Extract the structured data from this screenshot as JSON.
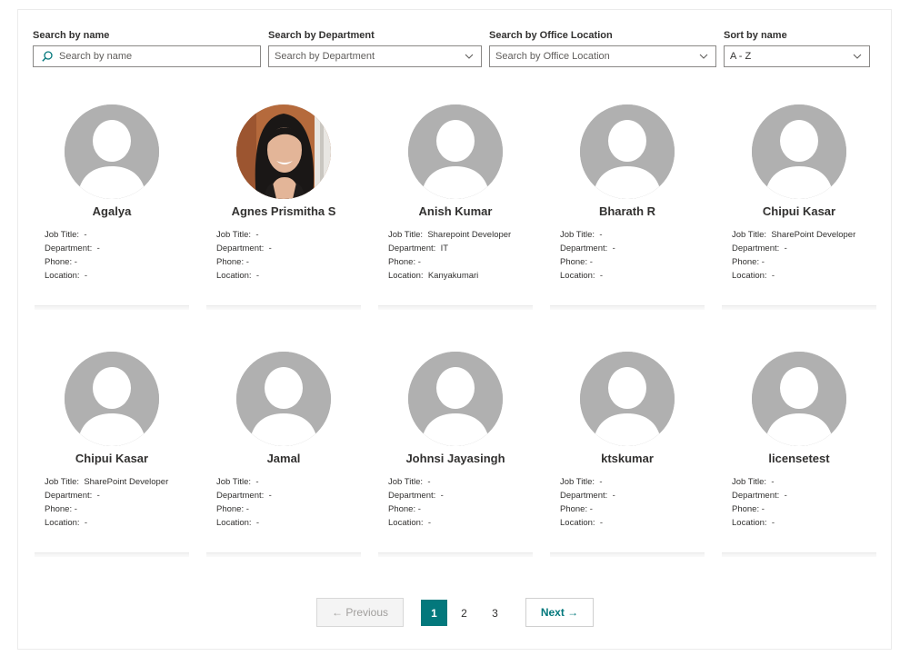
{
  "filters": {
    "name": {
      "label": "Search by name",
      "placeholder": "Search by name"
    },
    "department": {
      "label": "Search by Department",
      "placeholder": "Search by Department"
    },
    "location": {
      "label": "Search by Office Location",
      "placeholder": "Search by Office Location"
    },
    "sort": {
      "label": "Sort by name",
      "value": "A - Z"
    }
  },
  "field_labels": {
    "job_title": "Job Title:",
    "department": "Department:",
    "phone": "Phone:",
    "location": "Location:"
  },
  "people": [
    {
      "name": "Agalya",
      "job_title": "-",
      "department": "-",
      "phone": "-",
      "location": "-",
      "photo": false
    },
    {
      "name": "Agnes Prismitha S",
      "job_title": "-",
      "department": "-",
      "phone": "-",
      "location": "-",
      "photo": true
    },
    {
      "name": "Anish Kumar",
      "job_title": "Sharepoint Developer",
      "department": "IT",
      "phone": "-",
      "location": "Kanyakumari",
      "photo": false
    },
    {
      "name": "Bharath R",
      "job_title": "-",
      "department": "-",
      "phone": "-",
      "location": "-",
      "photo": false
    },
    {
      "name": "Chipui Kasar",
      "job_title": "SharePoint Developer",
      "department": "-",
      "phone": "-",
      "location": "-",
      "photo": false
    },
    {
      "name": "Chipui Kasar",
      "job_title": "SharePoint Developer",
      "department": "-",
      "phone": "-",
      "location": "-",
      "photo": false
    },
    {
      "name": "Jamal",
      "job_title": "-",
      "department": "-",
      "phone": "-",
      "location": "-",
      "photo": false
    },
    {
      "name": "Johnsi Jayasingh",
      "job_title": "-",
      "department": "-",
      "phone": "-",
      "location": "-",
      "photo": false
    },
    {
      "name": "ktskumar",
      "job_title": "-",
      "department": "-",
      "phone": "-",
      "location": "-",
      "photo": false
    },
    {
      "name": "licensetest",
      "job_title": "-",
      "department": "-",
      "phone": "-",
      "location": "-",
      "photo": false
    }
  ],
  "pagination": {
    "previous": "← Previous",
    "next": "Next →",
    "pages": [
      "1",
      "2",
      "3"
    ],
    "current": "1"
  },
  "colors": {
    "accent": "#03787c",
    "avatar_placeholder": "#b0b0b0"
  },
  "icons": {
    "search": "search-icon",
    "dropdown": "chevron-down-icon",
    "avatar": "person-icon"
  }
}
